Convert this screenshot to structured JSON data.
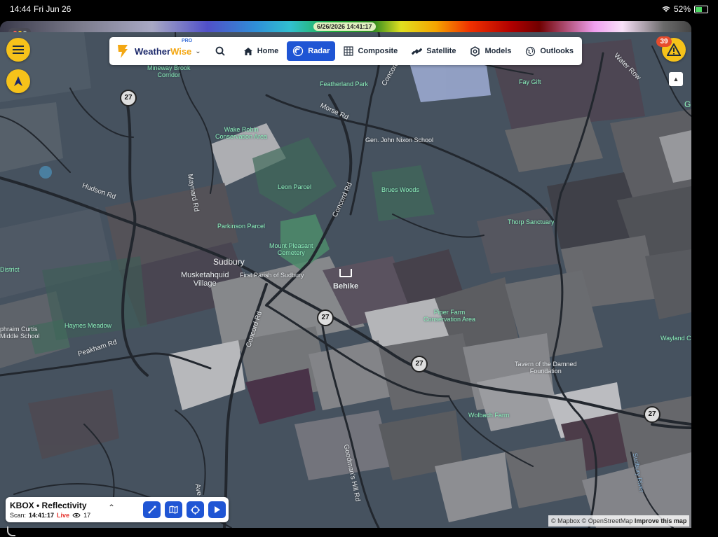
{
  "status_bar": {
    "time": "14:44",
    "date": "Fri Jun 26",
    "battery": "52%"
  },
  "scale": {
    "timestamp": "6/26/2026 14:41:17"
  },
  "nav": {
    "brand_weather": "Weather",
    "brand_wise": "Wise",
    "brand_tier": "PRO",
    "items": [
      {
        "label": "Home",
        "icon": "home-icon"
      },
      {
        "label": "Radar",
        "icon": "radar-icon",
        "active": true
      },
      {
        "label": "Composite",
        "icon": "grid-icon"
      },
      {
        "label": "Satellite",
        "icon": "satellite-icon"
      },
      {
        "label": "Models",
        "icon": "hexagon-icon"
      },
      {
        "label": "Outlooks",
        "icon": "globe-icon"
      }
    ]
  },
  "alerts": {
    "count": "39"
  },
  "compass": {
    "label": "▲"
  },
  "map": {
    "town": "Sudbury",
    "places": {
      "musketahquid": "Musketahquid\nVillage",
      "first_parish": "First Parish of Sudbury",
      "behike": "Behike",
      "nixon_school": "Gen. John Nixon School",
      "tavern": "Tavern of the Damned\nFoundation",
      "curtis_school": "phraim Curtis\nMiddle School",
      "district": "District",
      "wayland": "Wayland C",
      "edge_letter": "G"
    },
    "parks": {
      "mineway": "Mineway Brook\nCorridor",
      "featherland": "Featherland Park",
      "fay_gift": "Fay Gift",
      "wake_robin": "Wake Robin\nConservation Area",
      "leon": "Leon Parcel",
      "brues": "Brues Woods",
      "parkinson": "Parkinson Parcel",
      "mount_pleasant": "Mount Pleasant\nCemetery",
      "thorp": "Thorp Sanctuary",
      "haynes": "Haynes Meadow",
      "piper": "Piper Farm\nConservation Area",
      "wolbach": "Wolbach Farm"
    },
    "roads": {
      "hudson": "Hudson Rd",
      "maynard": "Maynard Rd",
      "morse": "Morse Rd",
      "concord_north": "Concord Rd",
      "concord_mid": "Concord Rd",
      "concord_top": "Concord",
      "peakham": "Peakham Rd",
      "water_row": "Water Row",
      "goodmans": "Goodman's Hill Rd",
      "sudbury_river": "Sudbury River",
      "ave": "Ave"
    },
    "route_shield": "27"
  },
  "radar_panel": {
    "station": "KBOX • Reflectivity",
    "scan_label": "Scan:",
    "scan_time": "14:41:17",
    "live": "Live",
    "viewers": "17"
  },
  "attribution": {
    "mapbox": "© Mapbox",
    "osm": "© OpenStreetMap",
    "improve": "Improve this map"
  }
}
